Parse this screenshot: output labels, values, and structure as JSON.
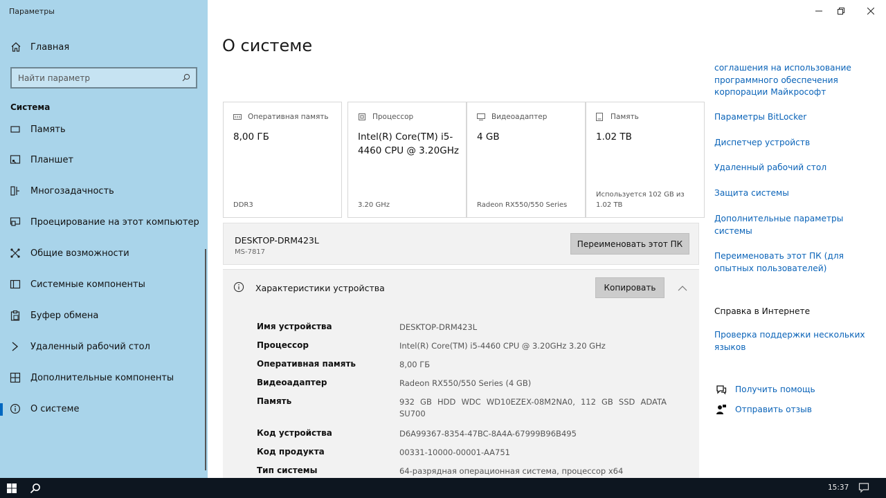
{
  "app": {
    "title": "Параметры"
  },
  "sidebar": {
    "home_label": "Главная",
    "search_placeholder": "Найти параметр",
    "section_title": "Система",
    "items": [
      {
        "label": "Память",
        "icon": "storage-icon"
      },
      {
        "label": "Планшет",
        "icon": "tablet-icon"
      },
      {
        "label": "Многозадачность",
        "icon": "multitasking-icon"
      },
      {
        "label": "Проецирование на этот компьютер",
        "icon": "projecting-icon"
      },
      {
        "label": "Общие возможности",
        "icon": "shared-experiences-icon"
      },
      {
        "label": "Системные компоненты",
        "icon": "system-components-icon"
      },
      {
        "label": "Буфер обмена",
        "icon": "clipboard-icon"
      },
      {
        "label": "Удаленный рабочий стол",
        "icon": "remote-desktop-icon"
      },
      {
        "label": "Дополнительные компоненты",
        "icon": "optional-features-icon"
      },
      {
        "label": "О системе",
        "icon": "info-icon",
        "active": true
      }
    ]
  },
  "main": {
    "title": "О системе",
    "cards": [
      {
        "label": "Оперативная память",
        "value": "8,00 ГБ",
        "sub": "DDR3",
        "icon": "ram-icon"
      },
      {
        "label": "Процессор",
        "value": "Intel(R) Core(TM) i5-4460  CPU @ 3.20GHz",
        "sub": "3.20 GHz",
        "icon": "cpu-icon"
      },
      {
        "label": "Видеоадаптер",
        "value": "4 GB",
        "sub": "Radeon RX550/550 Series",
        "icon": "gpu-icon"
      },
      {
        "label": "Память",
        "value": "1.02 TB",
        "sub": "Используется 102 GB из 1.02 TB",
        "icon": "storage-icon"
      }
    ],
    "pc_name": "DESKTOP-DRM423L",
    "pc_model": "MS-7817",
    "rename_button": "Переименовать этот ПК",
    "specs_title": "Характеристики устройства",
    "copy_button": "Копировать",
    "specs": [
      {
        "key": "Имя устройства",
        "value": "DESKTOP-DRM423L"
      },
      {
        "key": "Процессор",
        "value": "Intel(R) Core(TM) i5-4460  CPU @ 3.20GHz   3.20 GHz"
      },
      {
        "key": "Оперативная память",
        "value": "8,00 ГБ"
      },
      {
        "key": "Видеоадаптер",
        "value": "Radeon RX550/550 Series (4 GB)"
      },
      {
        "key": "Память",
        "value": "932 GB HDD WDC WD10EZEX-08M2NA0, 112 GB SSD ADATA SU700"
      },
      {
        "key": "Код устройства",
        "value": "D6A99367-8354-47BC-8A4A-67999B96B495"
      },
      {
        "key": "Код продукта",
        "value": "00331-10000-00001-AA751"
      },
      {
        "key": "Тип системы",
        "value": "64-разрядная операционная система, процессор x64"
      }
    ]
  },
  "related": {
    "links": [
      "соглашения на использование программного обеспечения корпорации Майкрософт",
      "Параметры BitLocker",
      "Диспетчер устройств",
      "Удаленный рабочий стол",
      "Защита системы",
      "Дополнительные параметры системы",
      "Переименовать этот ПК (для опытных пользователей)"
    ],
    "web_help_title": "Справка в Интернете",
    "web_help_link": "Проверка поддержки нескольких языков",
    "get_help": "Получить помощь",
    "feedback": "Отправить отзыв"
  },
  "taskbar": {
    "time": "15:37"
  },
  "colors": {
    "sidebar_bg": "#a9d4ea",
    "accent": "#0067c0",
    "link": "#0a63b8",
    "taskbar": "#0d1620"
  }
}
